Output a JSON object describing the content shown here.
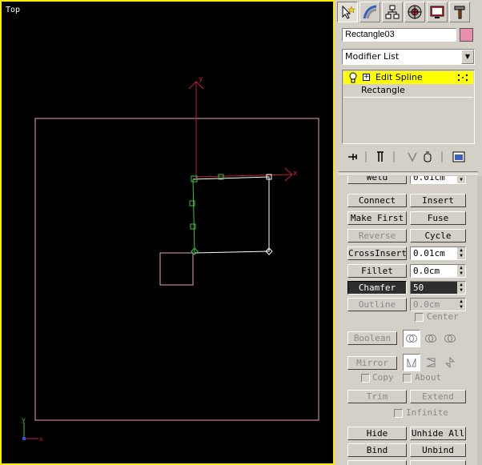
{
  "viewport": {
    "label": "Top",
    "axis_x": "x",
    "axis_y": "y"
  },
  "panel": {
    "tabs": [
      {
        "name": "create-tab",
        "icon": "pointer-star-icon"
      },
      {
        "name": "modify-tab",
        "icon": "rainbow-arc-icon"
      },
      {
        "name": "hierarchy-tab",
        "icon": "hierarchy-icon"
      },
      {
        "name": "motion-tab",
        "icon": "motion-wheel-icon"
      },
      {
        "name": "display-tab",
        "icon": "monitor-icon"
      },
      {
        "name": "utilities-tab",
        "icon": "hammer-icon"
      }
    ],
    "object_name": "Rectangle03",
    "object_color": "#e98fae",
    "modifier_list": "Modifier List",
    "stack": {
      "item1": "Edit Spline",
      "item2": "Rectangle"
    }
  },
  "rollout": {
    "weld": "Weld",
    "weld_value": "0.01cm",
    "connect": "Connect",
    "insert": "Insert",
    "make_first": "Make First",
    "fuse": "Fuse",
    "reverse": "Reverse",
    "cycle": "Cycle",
    "crossinsert": "CrossInsert",
    "crossinsert_value": "0.01cm",
    "fillet": "Fillet",
    "fillet_value": "0.0cm",
    "chamfer": "Chamfer",
    "chamfer_value": "50",
    "outline": "Outline",
    "outline_value": "0.0cm",
    "center": "Center",
    "boolean": "Boolean",
    "mirror": "Mirror",
    "copy": "Copy",
    "about": "About",
    "trim": "Trim",
    "extend": "Extend",
    "infinite": "Infinite",
    "hide": "Hide",
    "unhide_all": "Unhide All",
    "bind": "Bind",
    "unbind": "Unbind"
  }
}
